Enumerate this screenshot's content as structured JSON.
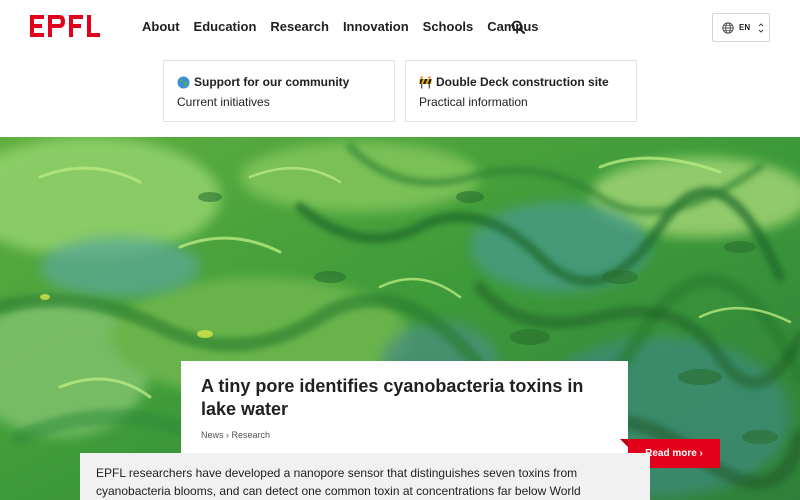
{
  "brand": {
    "logo_text": "EPFL",
    "accent_color": "#e2001a"
  },
  "nav": {
    "items": [
      "About",
      "Education",
      "Research",
      "Innovation",
      "Schools",
      "Campus"
    ],
    "search_icon": "search-icon"
  },
  "language": {
    "code": "EN",
    "icon": "globe-icon"
  },
  "quick_links": [
    {
      "icon": "globe-icon",
      "title": "Support for our community",
      "subtitle": "Current initiatives"
    },
    {
      "icon": "construction-barrier-icon",
      "title": "Double Deck construction site",
      "subtitle": "Practical information"
    }
  ],
  "hero": {
    "headline": "A tiny pore identifies cyanobacteria toxins in lake water",
    "breadcrumb": [
      "News",
      "Research"
    ],
    "breadcrumb_separator": "›",
    "read_more_label": "Read more ›",
    "summary": "EPFL researchers have developed a nanopore sensor that distinguishes seven toxins from cyanobacteria blooms, and can detect one common toxin at concentrations far below World"
  }
}
